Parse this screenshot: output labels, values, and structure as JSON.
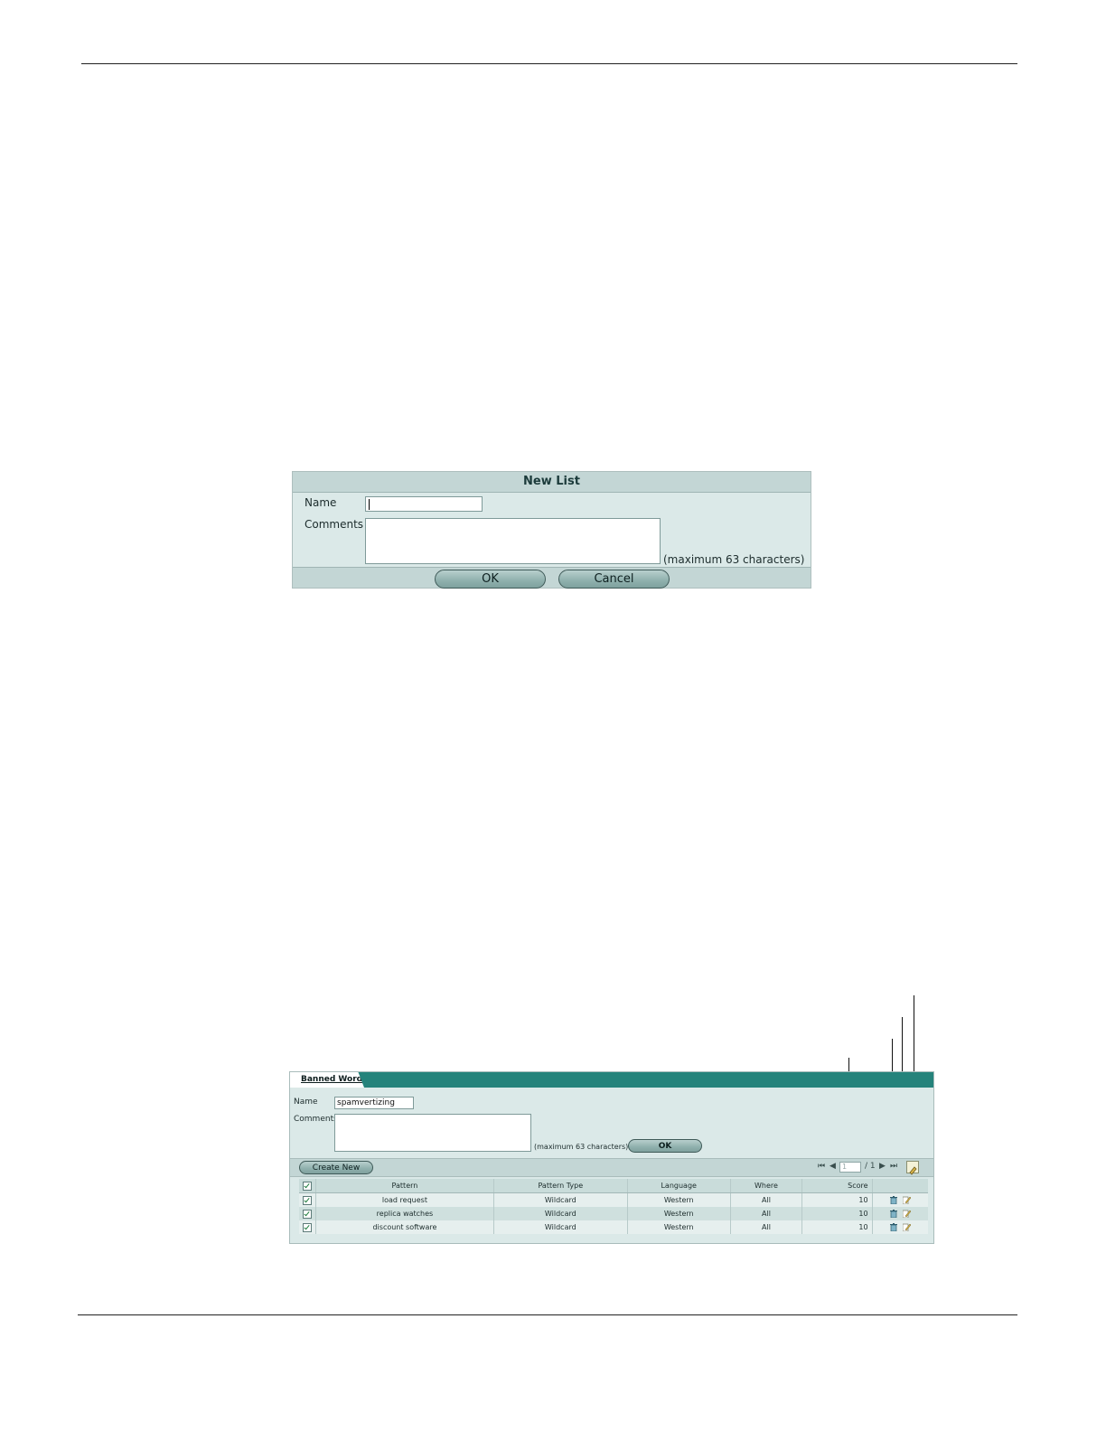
{
  "new_list": {
    "title": "New List",
    "name_label": "Name",
    "name_value": "",
    "comments_label": "Comments",
    "comments_value": "",
    "max_hint": "(maximum 63 characters)",
    "ok_label": "OK",
    "cancel_label": "Cancel"
  },
  "banned_word": {
    "tab_label": "Banned Word",
    "name_label": "Name",
    "name_value": "spamvertizing",
    "comments_label": "Comments",
    "comments_value": "",
    "max_hint": "(maximum 63 characters)",
    "ok_label": "OK",
    "create_new_label": "Create New",
    "pager": {
      "current": "1",
      "total": "/ 1"
    },
    "columns": [
      "Pattern",
      "Pattern Type",
      "Language",
      "Where",
      "Score"
    ],
    "rows": [
      {
        "pattern": "load request",
        "type": "Wildcard",
        "language": "Western",
        "where": "All",
        "score": "10"
      },
      {
        "pattern": "replica watches",
        "type": "Wildcard",
        "language": "Western",
        "where": "All",
        "score": "10"
      },
      {
        "pattern": "discount software",
        "type": "Wildcard",
        "language": "Western",
        "where": "All",
        "score": "10"
      }
    ],
    "colors": {
      "tab_bar": "#25837b",
      "panel": "#dbe9e8"
    }
  }
}
